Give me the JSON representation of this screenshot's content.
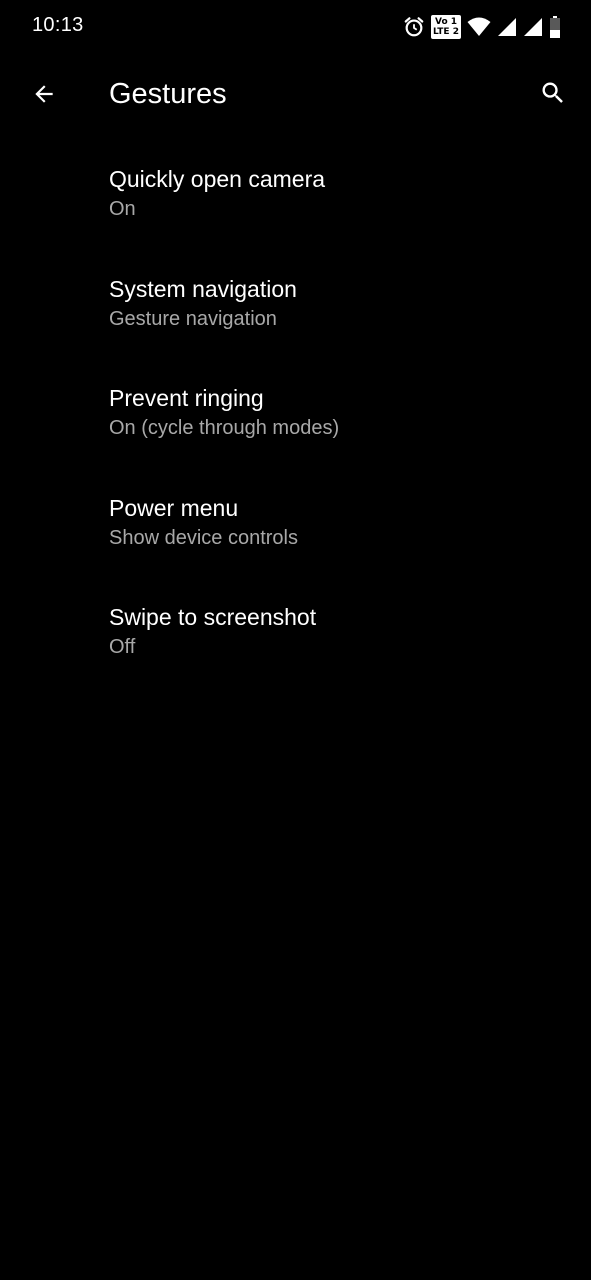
{
  "status_bar": {
    "time": "10:13",
    "volte_top": "Vo 1",
    "volte_bottom": "LTE 2",
    "icons": [
      "alarm-icon",
      "volte-icon",
      "wifi-icon",
      "signal-icon",
      "signal-icon",
      "battery-icon"
    ]
  },
  "toolbar": {
    "title": "Gestures",
    "back_icon": "arrow-back-icon",
    "search_icon": "search-icon"
  },
  "settings": [
    {
      "title": "Quickly open camera",
      "summary": "On"
    },
    {
      "title": "System navigation",
      "summary": "Gesture navigation"
    },
    {
      "title": "Prevent ringing",
      "summary": "On (cycle through modes)"
    },
    {
      "title": "Power menu",
      "summary": "Show device controls"
    },
    {
      "title": "Swipe to screenshot",
      "summary": "Off"
    }
  ],
  "colors": {
    "background": "#000000",
    "primary_text": "#ffffff",
    "secondary_text": "#a8a8a8"
  }
}
